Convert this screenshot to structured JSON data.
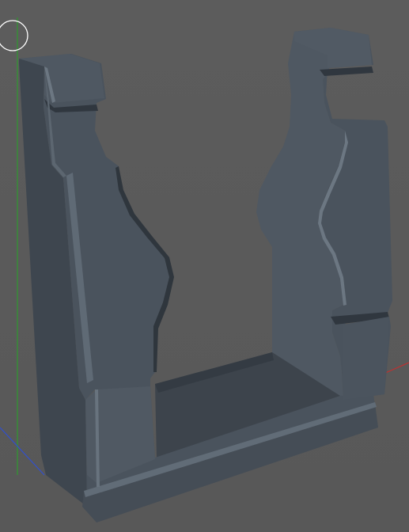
{
  "viewport": {
    "background_color": "#5a5a5a",
    "model_name": "u-shaped-bracket"
  },
  "colors": {
    "axis_y": "#2e9a2e",
    "axis_x": "#c03030",
    "axis_z": "#3050d0",
    "gizmo": "#ffffff",
    "model_front": "#4a535d",
    "model_side": "#3e464f",
    "model_highlight": "#6c7782",
    "model_dark": "#30373f"
  },
  "icons": {
    "gizmo": "view-origin-circle-icon"
  }
}
